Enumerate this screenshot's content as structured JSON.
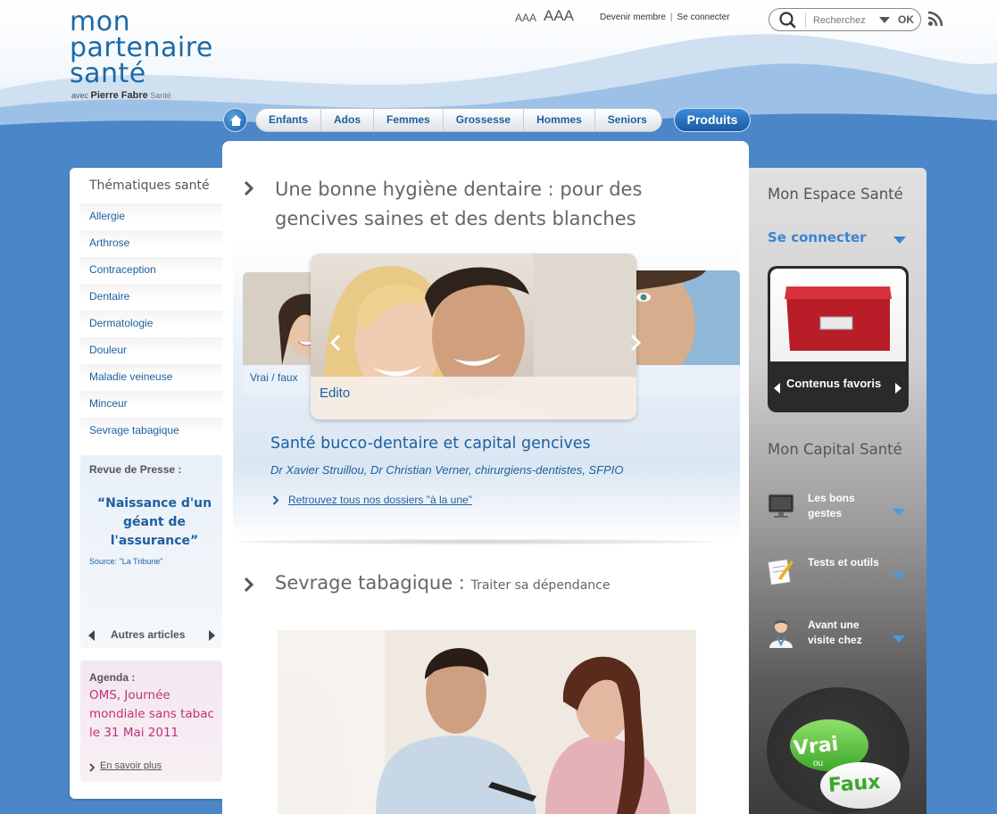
{
  "header": {
    "logo_line1": "mon",
    "logo_line2": "partenaire",
    "logo_line3": "santé",
    "logo_avec": "avec",
    "logo_brand": "Pierre Fabre",
    "logo_brand_sub": "Santé",
    "text_size_small": "AAA",
    "text_size_large": "AAA",
    "link_member": "Devenir membre",
    "link_login": "Se connecter",
    "search_placeholder": "Recherchez",
    "search_ok": "OK"
  },
  "nav": {
    "items": [
      "Enfants",
      "Ados",
      "Femmes",
      "Grossesse",
      "Hommes",
      "Seniors"
    ],
    "produits": "Produits"
  },
  "left": {
    "title": "Thématiques santé",
    "items": [
      "Allergie",
      "Arthrose",
      "Contraception",
      "Dentaire",
      "Dermatologie",
      "Douleur",
      "Maladie veineuse",
      "Minceur",
      "Sevrage tabagique"
    ],
    "revue_title": "Revue de Presse :",
    "revue_quote": "“Naissance d'un géant de l'assurance”",
    "revue_source": "Source: \"La Tribune\"",
    "revue_more": "Autres articles",
    "agenda_title": "Agenda :",
    "agenda_text": "OMS, Journée mondiale sans tabac le 31 Mai 2011",
    "agenda_more": "En savoir plus"
  },
  "center": {
    "headline": "Une bonne hygiène dentaire : pour des gencives saines et des dents blanches",
    "slide_left_caption": "Vrai / faux",
    "slide_main_caption": "Edito",
    "feature_title": "Santé bucco-dentaire et capital gencives",
    "feature_authors": "Dr Xavier Struillou, Dr Christian Verner, chirurgiens-dentistes, SFPIO",
    "feature_link": "Retrouvez tous nos dossiers \"à la une\"",
    "section2_title": "Sevrage tabagique :",
    "section2_sub": "Traiter sa dépendance"
  },
  "right": {
    "espace_title": "Mon Espace Santé",
    "connect": "Se connecter",
    "favoris": "Contenus favoris",
    "capital_title": "Mon Capital Santé",
    "capital_items": [
      "Les bons gestes",
      "Tests et outils",
      "Avant une visite chez"
    ],
    "vf_vrai": "Vrai",
    "vf_ou": "ou",
    "vf_faux": "Faux"
  },
  "colors": {
    "background": "#4a86c8",
    "brand_blue": "#1d5f9f",
    "link_blue": "#3b84d4",
    "agenda_pink": "#c2307a",
    "vf_green": "#3da82a"
  }
}
